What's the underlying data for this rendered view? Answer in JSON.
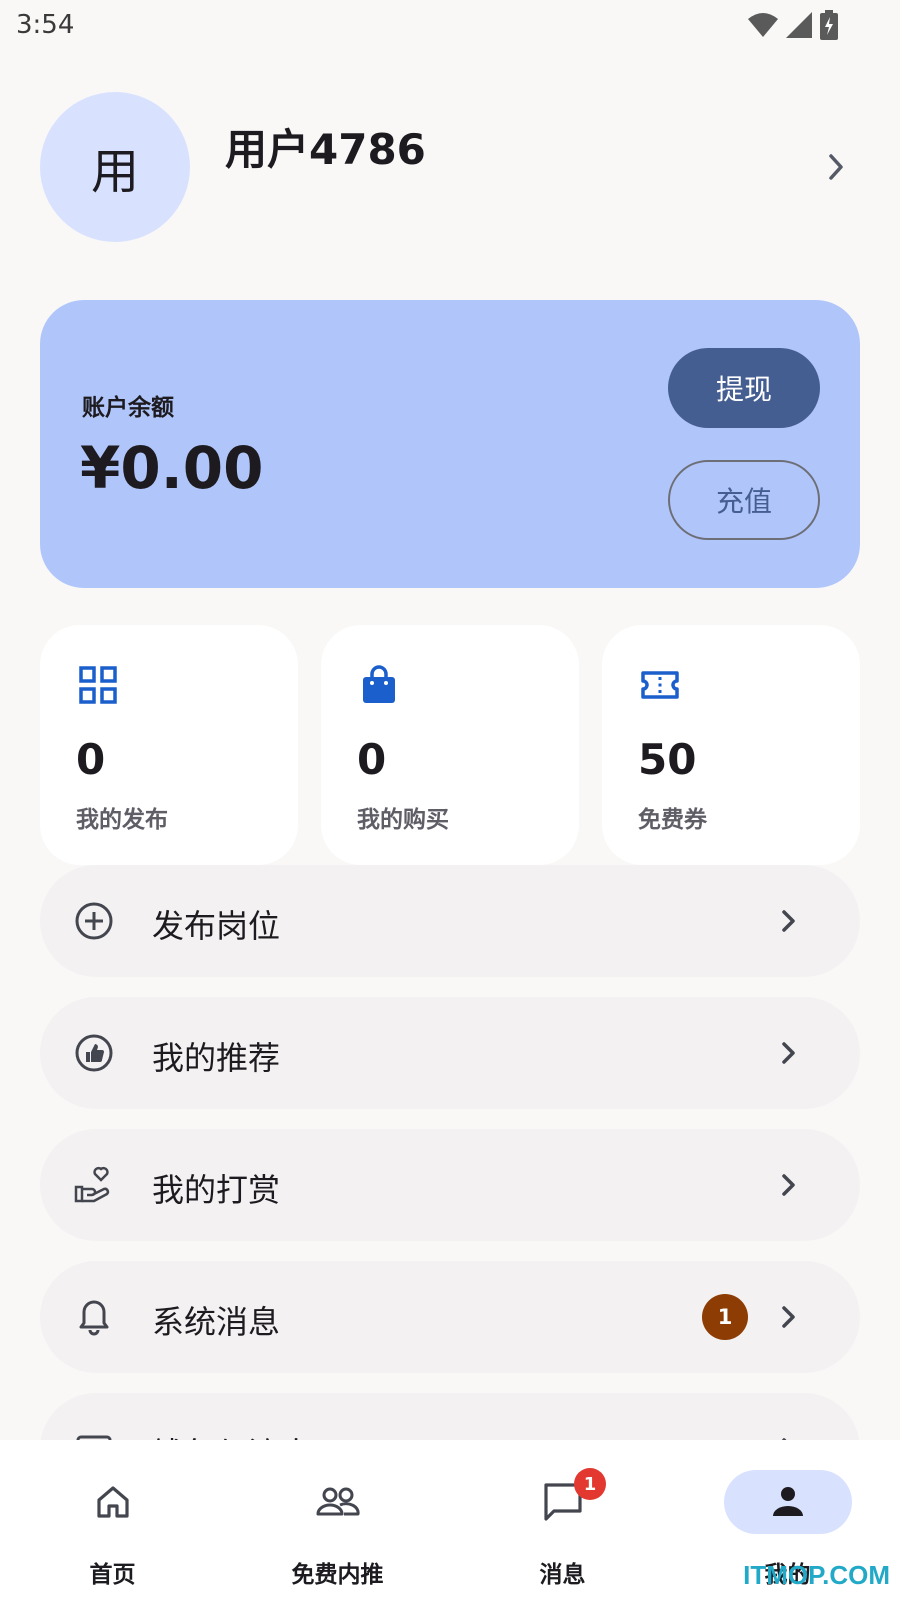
{
  "status_bar": {
    "time": "3:54"
  },
  "profile": {
    "avatar_text": "用",
    "username": "用户4786"
  },
  "balance": {
    "label": "账户余额",
    "amount": "¥0.00",
    "withdraw_label": "提现",
    "recharge_label": "充值"
  },
  "stats": [
    {
      "icon": "grid-icon",
      "value": "0",
      "label": "我的发布"
    },
    {
      "icon": "shopping-bag-icon",
      "value": "0",
      "label": "我的购买"
    },
    {
      "icon": "ticket-icon",
      "value": "50",
      "label": "免费券"
    }
  ],
  "menu": [
    {
      "icon": "add-circle-icon",
      "label": "发布岗位"
    },
    {
      "icon": "thumb-up-icon",
      "label": "我的推荐"
    },
    {
      "icon": "hand-heart-icon",
      "label": "我的打赏"
    },
    {
      "icon": "bell-icon",
      "label": "系统消息",
      "badge": "1"
    },
    {
      "icon": "wallet-icon",
      "label": "钱包与流水"
    }
  ],
  "bottom_nav": [
    {
      "icon": "home-icon",
      "label": "首页"
    },
    {
      "icon": "people-icon",
      "label": "免费内推"
    },
    {
      "icon": "chat-icon",
      "label": "消息",
      "badge": "1"
    },
    {
      "icon": "person-icon",
      "label": "我的",
      "active": true
    }
  ],
  "watermark": "ITMOP.COM",
  "colors": {
    "primary": "#455e91",
    "card_blue": "#b0c6fa",
    "avatar_bg": "#d8e2ff",
    "icon_blue": "#1b5fcc",
    "badge_brown": "#8d3c03",
    "badge_red": "#e2382f"
  }
}
